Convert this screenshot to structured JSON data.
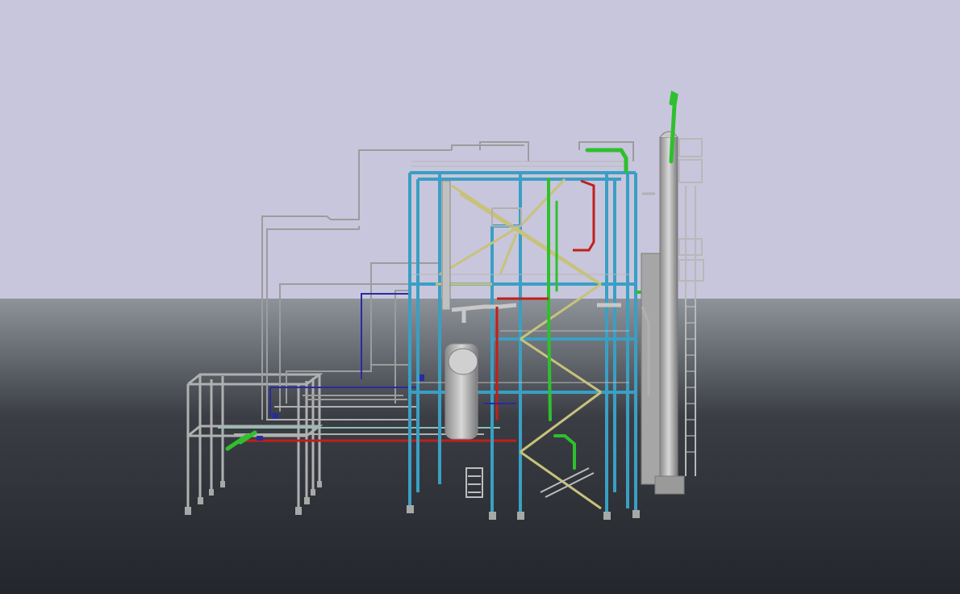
{
  "viewport": {
    "background_sky": "#c8c6dc",
    "background_ground_top": "#8e939a",
    "background_ground_bottom": "#23262b"
  },
  "model": {
    "colors": {
      "steel_structure": "#3a9fc4",
      "piping_gray": "#9a9a9a",
      "piping_light": "#c8c8c8",
      "piping_green": "#2ec02e",
      "piping_red": "#c0201c",
      "piping_blue": "#2a2aa0",
      "bracing_yellow": "#c8c27a",
      "vessel_gray": "#b8b8b8"
    }
  }
}
